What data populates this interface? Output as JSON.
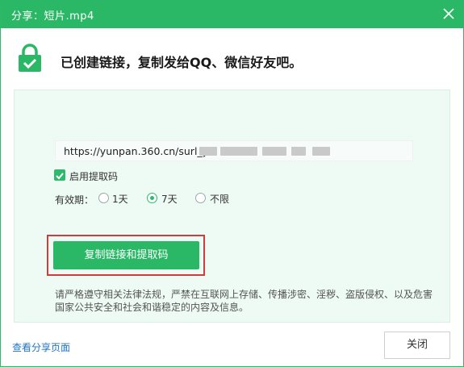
{
  "window": {
    "title": "分享：短片.mp4"
  },
  "header": {
    "headline": "已创建链接，复制发给QQ、微信好友吧。"
  },
  "share": {
    "link": "https://yunpan.360.cn/surl_y",
    "enable_code_label": "启用提取码",
    "enable_code_checked": true,
    "validity_label": "有效期：",
    "options": [
      "1天",
      "7天",
      "不限"
    ],
    "selected_option": "7天",
    "copy_button": "复制链接和提取码",
    "notice": "请严格遵守相关法律法规，严禁在互联网上存储、传播涉密、淫秽、盗版侵权、以及危害国家公共安全和社会和谐稳定的内容及信息。"
  },
  "footer": {
    "view_page_link": "查看分享页面",
    "close_button": "关闭"
  },
  "colors": {
    "accent": "#2bb866",
    "highlight": "#d23b3b",
    "link": "#1e74c7"
  }
}
